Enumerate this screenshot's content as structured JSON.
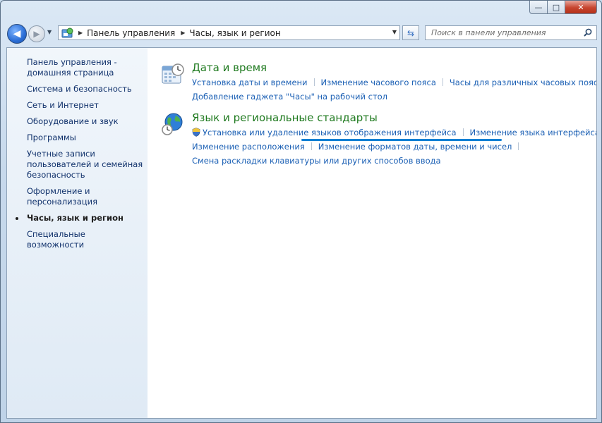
{
  "window": {
    "minimize_label": "—",
    "maximize_label": "□",
    "close_label": "✕"
  },
  "navbar": {
    "back_icon": "back-arrow-icon",
    "forward_icon": "forward-arrow-icon",
    "breadcrumbs": [
      "Панель управления",
      "Часы, язык и регион"
    ],
    "search_placeholder": "Поиск в панели управления"
  },
  "sidebar": {
    "items": [
      {
        "label": "Панель управления - домашняя страница",
        "current": false
      },
      {
        "label": "Система и безопасность",
        "current": false
      },
      {
        "label": "Сеть и Интернет",
        "current": false
      },
      {
        "label": "Оборудование и звук",
        "current": false
      },
      {
        "label": "Программы",
        "current": false
      },
      {
        "label": "Учетные записи пользователей и семейная безопасность",
        "current": false
      },
      {
        "label": "Оформление и персонализация",
        "current": false
      },
      {
        "label": "Часы, язык и регион",
        "current": true
      },
      {
        "label": "Специальные возможности",
        "current": false
      }
    ]
  },
  "categories": [
    {
      "title": "Дата и время",
      "icon": "calendar-clock-icon",
      "rows": [
        [
          "Установка даты и времени",
          "Изменение часового пояса",
          "Часы для различных часовых поясов"
        ],
        [
          "Добавление гаджета \"Часы\" на рабочий стол"
        ]
      ]
    },
    {
      "title": "Язык и региональные стандарты",
      "icon": "globe-clock-icon",
      "rows": [
        [
          "Установка или удаление языков отображения интерфейса",
          "Изменение языка интерфейса"
        ],
        [
          "Изменение расположения",
          "Изменение форматов даты, времени и чисел"
        ],
        [
          "Смена раскладки клавиатуры или других способов ввода"
        ]
      ]
    }
  ],
  "colors": {
    "link": "#1a5fb4",
    "category_title": "#1f7a1f",
    "highlight": "#0b7fd4"
  }
}
